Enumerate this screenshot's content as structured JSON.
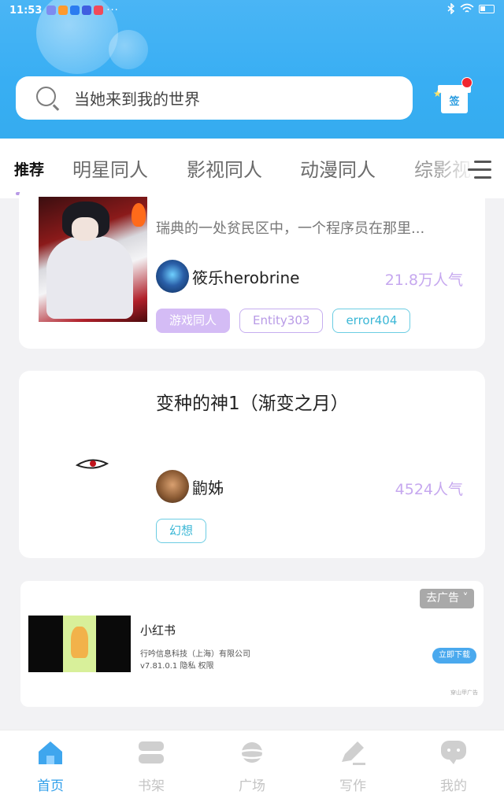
{
  "status_bar": {
    "time": "11:53",
    "more": "···"
  },
  "search": {
    "text": "当她来到我的世界"
  },
  "signin": {
    "label": "签"
  },
  "tabs": [
    {
      "label": "推荐",
      "active": true
    },
    {
      "label": "明星同人"
    },
    {
      "label": "影视同人"
    },
    {
      "label": "动漫同人"
    },
    {
      "label": "综影视"
    }
  ],
  "cards": [
    {
      "description": "瑞典的一处贫民区中，一个程序员在那里...",
      "author": "筱乐herobrine",
      "popularity": "21.8万人气",
      "tags": [
        "游戏同人",
        "Entity303",
        "error404"
      ]
    },
    {
      "title": "变种的神1（渐变之月）",
      "author": "鼩姊",
      "popularity": "4524人气",
      "tags": [
        "幻想"
      ]
    }
  ],
  "ad": {
    "close_label": "去广告",
    "app_name": "小红书",
    "company": "行吟信息科技（上海）有限公司",
    "meta": "v7.81.0.1  隐私  权限",
    "download_label": "立即下载",
    "source": "穿山甲广告"
  },
  "bottom_nav": [
    {
      "label": "首页",
      "icon": "home-icon",
      "active": true
    },
    {
      "label": "书架",
      "icon": "bookshelf-icon"
    },
    {
      "label": "广场",
      "icon": "planet-icon"
    },
    {
      "label": "写作",
      "icon": "pen-icon"
    },
    {
      "label": "我的",
      "icon": "chat-bubble-icon"
    }
  ],
  "colors": {
    "header": "#38aef3",
    "accent_purple": "#c6a8ef",
    "accent_blue": "#2f9eea",
    "badge_red": "#f0262f"
  }
}
